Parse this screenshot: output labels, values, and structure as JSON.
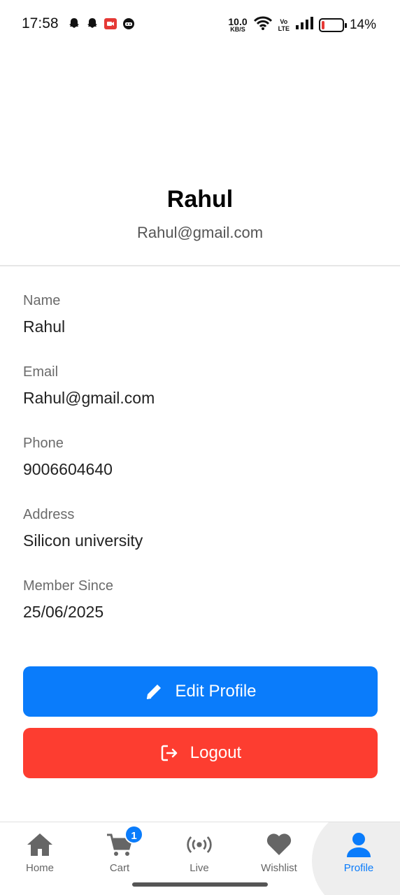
{
  "status_bar": {
    "time": "17:58",
    "left_icons": [
      "snapchat-icon",
      "snapchat-icon",
      "screen-record-icon",
      "game-icon"
    ],
    "speed_value": "10.0",
    "speed_unit": "KB/S",
    "volte_top": "Vo",
    "volte_bottom": "LTE",
    "battery_percent": "14%",
    "battery_level": 0.14
  },
  "profile": {
    "name": "Rahul",
    "email": "Rahul@gmail.com"
  },
  "details": [
    {
      "label": "Name",
      "value": "Rahul"
    },
    {
      "label": "Email",
      "value": "Rahul@gmail.com"
    },
    {
      "label": "Phone",
      "value": "9006604640"
    },
    {
      "label": "Address",
      "value": "Silicon university"
    },
    {
      "label": "Member Since",
      "value": "25/06/2025"
    }
  ],
  "buttons": {
    "edit": "Edit Profile",
    "logout": "Logout"
  },
  "nav": {
    "items": [
      {
        "label": "Home",
        "icon": "home-icon"
      },
      {
        "label": "Cart",
        "icon": "cart-icon",
        "badge": "1"
      },
      {
        "label": "Live",
        "icon": "broadcast-icon"
      },
      {
        "label": "Wishlist",
        "icon": "heart-icon"
      },
      {
        "label": "Profile",
        "icon": "user-icon"
      }
    ],
    "active": "Profile"
  },
  "colors": {
    "primary": "#0a7cfb",
    "danger": "#fd3d30",
    "nav_inactive": "#666666"
  }
}
